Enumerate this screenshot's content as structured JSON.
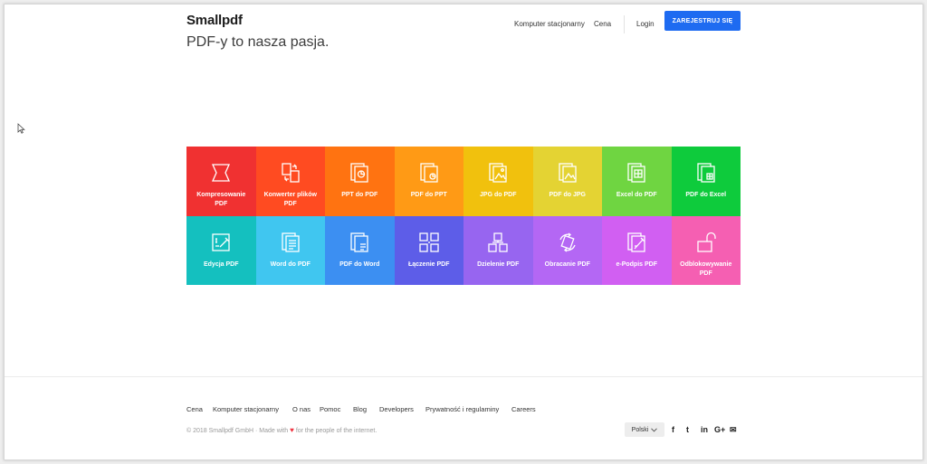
{
  "header": {
    "logo": "Smallpdf",
    "nav": {
      "desktop": "Komputer stacjonarny",
      "price": "Cena",
      "login": "Login"
    },
    "signup_label": "ZAREJESTRUJ SIĘ"
  },
  "hero": {
    "title": "PDF-y to nasza pasja."
  },
  "tools": [
    {
      "label": "Kompresowanie PDF",
      "icon": "compress-icon",
      "color": "#f03131"
    },
    {
      "label": "Konwerter plików PDF",
      "icon": "convert-icon",
      "color": "#ff4b21"
    },
    {
      "label": "PPT do PDF",
      "icon": "ppt-icon",
      "color": "#ff7311"
    },
    {
      "label": "PDF do PPT",
      "icon": "pdf-to-ppt-icon",
      "color": "#ff9a15"
    },
    {
      "label": "JPG do PDF",
      "icon": "jpg-icon",
      "color": "#f1c10d"
    },
    {
      "label": "PDF do JPG",
      "icon": "pdf-to-jpg-icon",
      "color": "#e4d333"
    },
    {
      "label": "Excel do PDF",
      "icon": "excel-icon",
      "color": "#6fd541"
    },
    {
      "label": "PDF do Excel",
      "icon": "pdf-to-excel-icon",
      "color": "#0ecb3c"
    },
    {
      "label": "Edycja PDF",
      "icon": "edit-icon",
      "color": "#14c0bf"
    },
    {
      "label": "Word do PDF",
      "icon": "word-icon",
      "color": "#40c6f0"
    },
    {
      "label": "PDF do Word",
      "icon": "pdf-to-word-icon",
      "color": "#3c8ff2"
    },
    {
      "label": "Łączenie PDF",
      "icon": "merge-icon",
      "color": "#5d5de8"
    },
    {
      "label": "Dzielenie PDF",
      "icon": "split-icon",
      "color": "#9765f0"
    },
    {
      "label": "Obracanie PDF",
      "icon": "rotate-icon",
      "color": "#b467f4"
    },
    {
      "label": "e-Podpis PDF",
      "icon": "esign-icon",
      "color": "#d15ff2"
    },
    {
      "label": "Odblokowywanie PDF",
      "icon": "unlock-icon",
      "color": "#f55fb2"
    }
  ],
  "footer": {
    "links": [
      "Cena",
      "Komputer stacjonarny",
      "O nas",
      "Pomoc",
      "Blog",
      "Developers",
      "Prywatność i regulaminy",
      "Careers"
    ],
    "copyright_prefix": "© 2018 Smallpdf GmbH  ·  Made with",
    "heart": "♥",
    "copyright_suffix": "for the people of the internet.",
    "language": "Polski",
    "social": [
      "f",
      "t",
      "in",
      "G+",
      "✉"
    ]
  }
}
